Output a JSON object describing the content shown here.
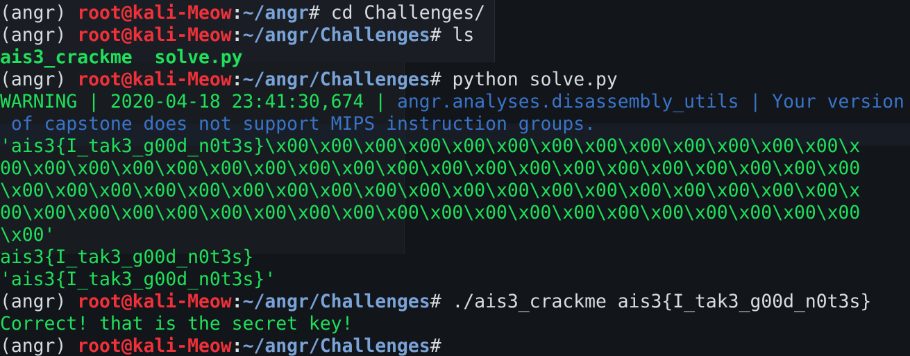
{
  "terminal": {
    "env": "(angr)",
    "user_host": "root@kali-Meow",
    "lines": [
      {
        "path": "~/angr",
        "cmd": " cd Challenges/"
      },
      {
        "path": "~/angr/Challenges",
        "cmd": " ls"
      },
      {
        "ls_output": "ais3_crackme  solve.py"
      },
      {
        "path": "~/angr/Challenges",
        "cmd": " python solve.py"
      },
      {
        "warning_prefix": "WARNING | 2020-04-18 23:41:30,674 | ",
        "warning_module": "angr.analyses.disassembly_utils",
        "warning_sep": " | ",
        "warning_msg1": "Your version",
        "warning_msg2": " of capstone does not support MIPS instruction groups."
      },
      {
        "out1": "'ais3{I_tak3_g00d_n0t3s}\\x00\\x00\\x00\\x00\\x00\\x00\\x00\\x00\\x00\\x00\\x00\\x00\\x00\\x",
        "out2": "00\\x00\\x00\\x00\\x00\\x00\\x00\\x00\\x00\\x00\\x00\\x00\\x00\\x00\\x00\\x00\\x00\\x00\\x00\\x00",
        "out3": "\\x00\\x00\\x00\\x00\\x00\\x00\\x00\\x00\\x00\\x00\\x00\\x00\\x00\\x00\\x00\\x00\\x00\\x00\\x00\\x",
        "out4": "00\\x00\\x00\\x00\\x00\\x00\\x00\\x00\\x00\\x00\\x00\\x00\\x00\\x00\\x00\\x00\\x00\\x00\\x00\\x00",
        "out5": "\\x00'"
      },
      {
        "flag": "ais3{I_tak3_g00d_n0t3s}"
      },
      {
        "flag_repr": "'ais3{I_tak3_g00d_n0t3s}'"
      },
      {
        "path": "~/angr/Challenges",
        "cmd": " ./ais3_crackme ais3{I_tak3_g00d_n0t3s}"
      },
      {
        "result": "Correct! that is the secret key!"
      },
      {
        "path": "~/angr/Challenges",
        "cmd": ""
      }
    ]
  }
}
